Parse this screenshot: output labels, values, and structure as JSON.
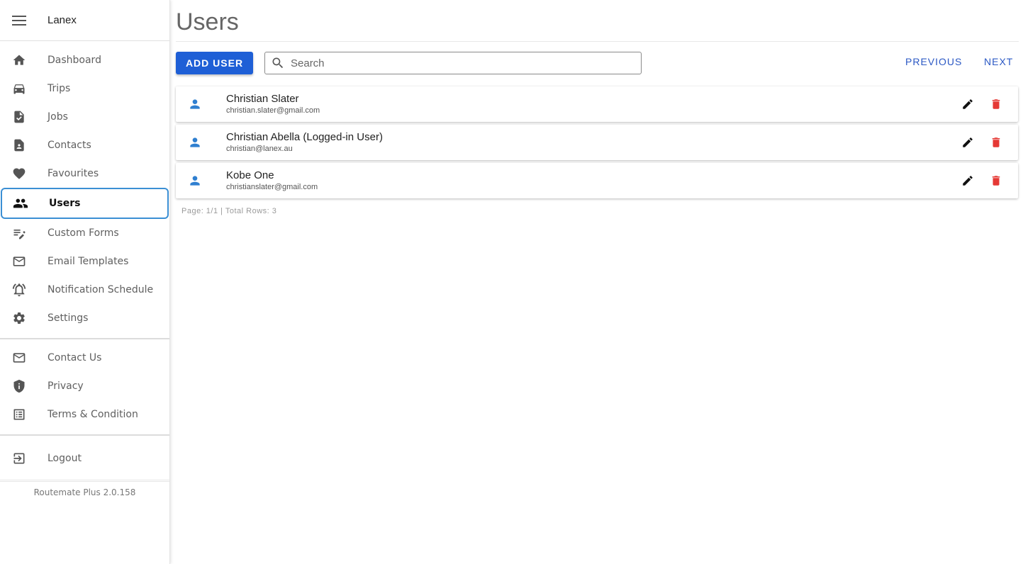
{
  "sidebar": {
    "brand": "Lanex",
    "main_items": [
      {
        "label": "Dashboard",
        "icon": "home-icon"
      },
      {
        "label": "Trips",
        "icon": "car-icon"
      },
      {
        "label": "Jobs",
        "icon": "task-icon"
      },
      {
        "label": "Contacts",
        "icon": "contact-icon"
      },
      {
        "label": "Favourites",
        "icon": "heart-icon"
      },
      {
        "label": "Users",
        "icon": "users-icon",
        "active": true
      },
      {
        "label": "Custom Forms",
        "icon": "edit-list-icon"
      },
      {
        "label": "Email Templates",
        "icon": "mail-icon"
      },
      {
        "label": "Notification Schedule",
        "icon": "bell-icon"
      },
      {
        "label": "Settings",
        "icon": "gear-icon"
      }
    ],
    "info_items": [
      {
        "label": "Contact Us",
        "icon": "mail-icon"
      },
      {
        "label": "Privacy",
        "icon": "shield-icon"
      },
      {
        "label": "Terms & Condition",
        "icon": "list-icon"
      }
    ],
    "logout_label": "Logout",
    "version": "Routemate Plus 2.0.158"
  },
  "page": {
    "title": "Users",
    "add_label": "ADD USER",
    "search_placeholder": "Search",
    "search_value": "",
    "prev_label": "PREVIOUS",
    "next_label": "NEXT",
    "footer": "Page: 1/1 | Total Rows: 3"
  },
  "users": [
    {
      "name": "Christian Slater",
      "email": "christian.slater@gmail.com"
    },
    {
      "name": "Christian Abella (Logged-in User)",
      "email": "christian@lanex.au"
    },
    {
      "name": "Kobe One",
      "email": "christianslater@gmail.com"
    }
  ],
  "colors": {
    "primary": "#1e5fd6",
    "link": "#2b58c4",
    "avatar": "#2f7fd0",
    "delete": "#e53935",
    "active_border": "#3b8fd4"
  }
}
